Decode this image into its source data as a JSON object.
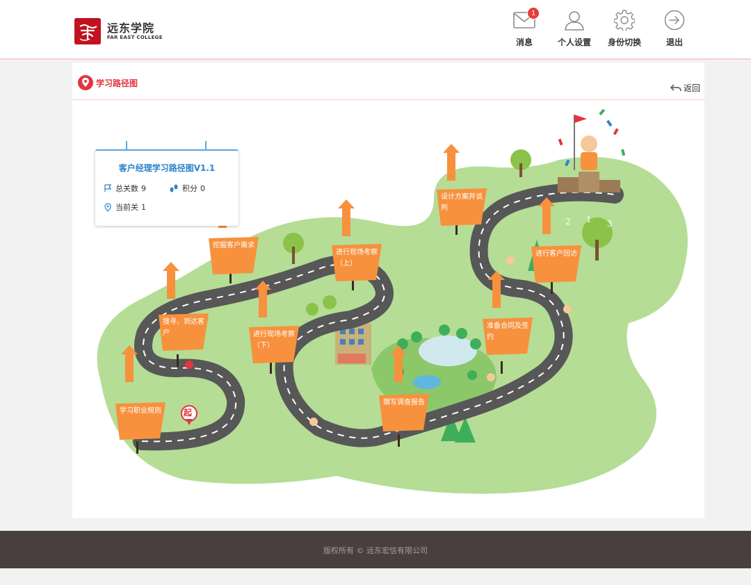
{
  "header": {
    "logo_cn": "远东学院",
    "logo_en": "FAR EAST COLLEGE",
    "nav": [
      {
        "label": "消息",
        "icon": "mail-icon",
        "badge": "1"
      },
      {
        "label": "个人设置",
        "icon": "user-icon"
      },
      {
        "label": "身份切换",
        "icon": "gear-icon"
      },
      {
        "label": "退出",
        "icon": "logout-icon"
      }
    ]
  },
  "page": {
    "title": "学习路径图",
    "back_label": "返回"
  },
  "card": {
    "title": "客户经理学习路径图V1.1",
    "total_label": "总关数",
    "total_value": "9",
    "score_label": "积分",
    "score_value": "0",
    "current_label": "当前关",
    "current_value": "1"
  },
  "milestones": [
    "学习职业规则",
    "搜寻、到达客户",
    "挖掘客户需求",
    "进行现场考察（下）",
    "进行现场考察（上）",
    "撰写调查报告",
    "设计方案并谈判",
    "准备合同及签约",
    "进行客户回访"
  ],
  "start_marker": "起",
  "podium": [
    "2",
    "1",
    "3"
  ],
  "footer": {
    "copyright": "版权所有 © 远东宏信有限公司"
  },
  "colors": {
    "accent": "#e2353f",
    "link_blue": "#2a84cc",
    "sign_orange": "#f7913d",
    "grass": "#a6d585",
    "road": "#575757",
    "footer_bg": "#4a3f3f"
  }
}
